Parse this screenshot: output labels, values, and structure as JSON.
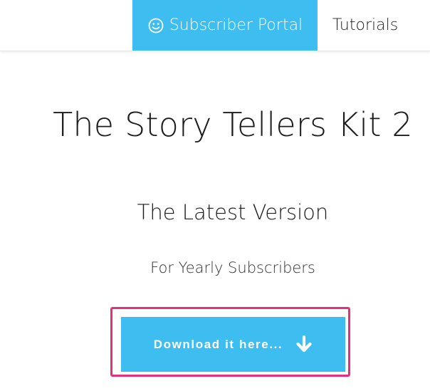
{
  "nav": {
    "portal": {
      "label": "Subscriber Portal",
      "icon": "smile-icon"
    },
    "tutorials_label": "Tutorials"
  },
  "main": {
    "title": "The Story Tellers Kit 2",
    "subtitle": "The Latest Version",
    "audience": "For Yearly Subscribers",
    "download": {
      "label": "Download it here...",
      "icon": "arrow-down-icon"
    }
  },
  "colors": {
    "accent": "#3dbdf0",
    "highlight": "#e8307a",
    "text": "#1c1c1c"
  }
}
